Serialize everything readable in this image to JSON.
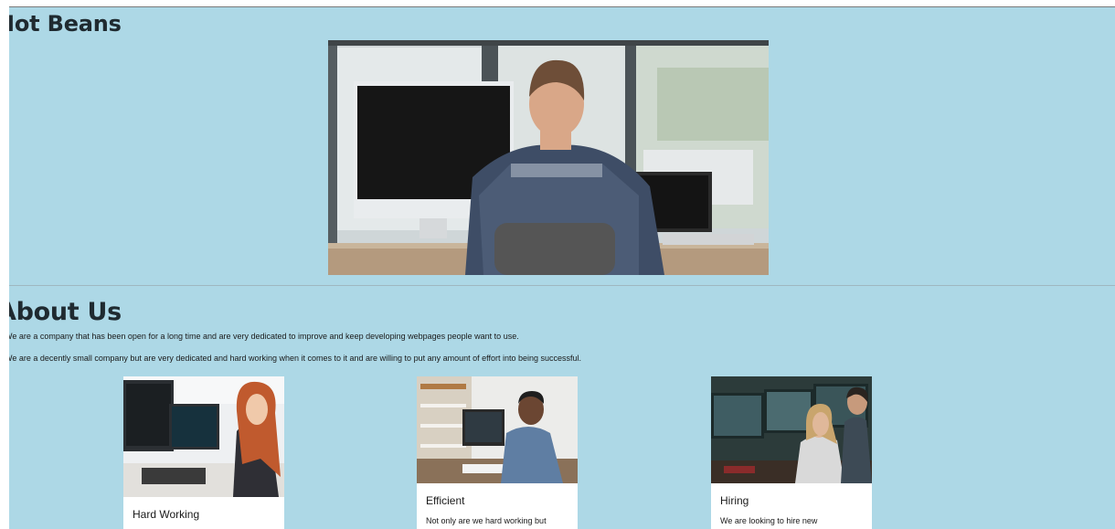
{
  "header": {
    "title": "Hot Beans"
  },
  "about": {
    "title": "About Us",
    "paragraphs": [
      "We are a company that has been open for a long time and are very dedicated to improve and keep developing webpages people want to use.",
      "We are a decently small company but are very dedicated and hard working when it comes to it and are willing to put any amount of effort into being successful."
    ]
  },
  "cards": [
    {
      "title": "Hard Working",
      "text": ""
    },
    {
      "title": "Efficient",
      "text": "Not only are we hard working but"
    },
    {
      "title": "Hiring",
      "text": "We are looking to hire new"
    }
  ],
  "colors": {
    "background": "#add8e6",
    "card": "#ffffff",
    "text": "#1f2a30"
  }
}
